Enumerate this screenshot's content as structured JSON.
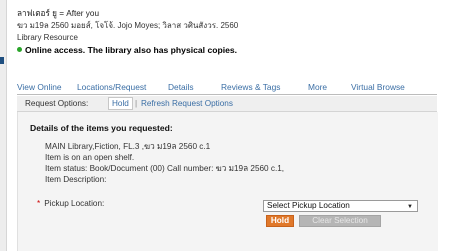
{
  "record": {
    "title": "ลาฟเตอร์ ยู = After you",
    "publication": "ฆว ม19ล 2560 มอยส์, โจโจ้. Jojo Moyes; วิลาส วศินสังวร. 2560",
    "format": "Library Resource",
    "availability": "Online access. The library also has physical copies."
  },
  "tabs": [
    "View Online",
    "Locations/Request",
    "Details",
    "Reviews & Tags",
    "More",
    "Virtual Browse"
  ],
  "request_options": {
    "label": "Request Options:",
    "hold_link": "Hold",
    "separator": "|",
    "refresh_link": "Refresh Request Options"
  },
  "details": {
    "heading": "Details of the items you requested:",
    "lines": [
      "MAIN Library,Fiction, FL.3 ,ฆว ม19ล 2560 c.1",
      "Item is on an open shelf.",
      "Item status: Book/Document (00) Call number: ฆว ม19ล 2560 c.1,",
      "Item Description:"
    ]
  },
  "pickup": {
    "required_marker": "*",
    "label": "Pickup Location:",
    "selected": "Select Pickup Location"
  },
  "buttons": {
    "hold": "Hold",
    "clear": "Clear Selection"
  },
  "colors": {
    "link": "#3a6ea5",
    "status_dot": "#2aa52a",
    "hold_button": "#e0782a",
    "clear_button": "#b5b5b5",
    "panel_background": "#f4f4f4"
  },
  "icons": {
    "availability": "green-dot-icon",
    "select": "caret-down-icon"
  }
}
